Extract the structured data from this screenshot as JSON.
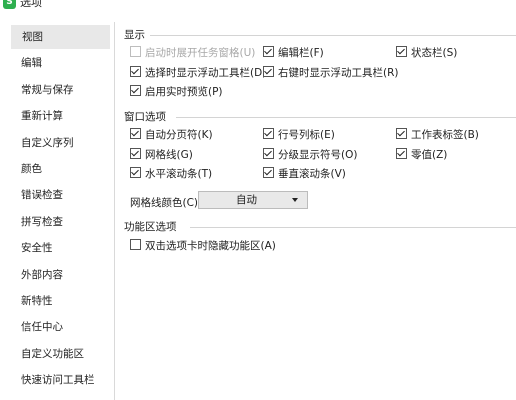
{
  "window": {
    "title": "选项",
    "app_icon_letter": "S"
  },
  "sidebar": {
    "items": [
      {
        "label": "视图",
        "active": true
      },
      {
        "label": "编辑"
      },
      {
        "label": "常规与保存"
      },
      {
        "label": "重新计算"
      },
      {
        "label": "自定义序列"
      },
      {
        "label": "颜色"
      },
      {
        "label": "错误检查"
      },
      {
        "label": "拼写检查"
      },
      {
        "label": "安全性"
      },
      {
        "label": "外部内容"
      },
      {
        "label": "新特性"
      },
      {
        "label": "信任中心"
      },
      {
        "label": "自定义功能区"
      },
      {
        "label": "快速访问工具栏"
      }
    ]
  },
  "display": {
    "title": "显示",
    "opts": {
      "startup_taskpane": {
        "label": "启动时展开任务窗格(U)",
        "checked": false,
        "disabled": true
      },
      "formula_bar": {
        "label": "编辑栏(F)",
        "checked": true
      },
      "status_bar": {
        "label": "状态栏(S)",
        "checked": true
      },
      "float_toolbar_select": {
        "label": "选择时显示浮动工具栏(D)",
        "checked": true
      },
      "float_toolbar_rightclick": {
        "label": "右键时显示浮动工具栏(R)",
        "checked": true
      },
      "live_preview": {
        "label": "启用实时预览(P)",
        "checked": true
      }
    }
  },
  "window_options": {
    "title": "窗口选项",
    "opts": {
      "auto_page_break": {
        "label": "自动分页符(K)",
        "checked": true
      },
      "row_col_headers": {
        "label": "行号列标(E)",
        "checked": true
      },
      "sheet_tabs": {
        "label": "工作表标签(B)",
        "checked": true
      },
      "gridlines": {
        "label": "网格线(G)",
        "checked": true
      },
      "outline_symbols": {
        "label": "分级显示符号(O)",
        "checked": true
      },
      "zero_values": {
        "label": "零值(Z)",
        "checked": true
      },
      "h_scrollbar": {
        "label": "水平滚动条(T)",
        "checked": true
      },
      "v_scrollbar": {
        "label": "垂直滚动条(V)",
        "checked": true
      }
    },
    "grid_color_label": "网格线颜色(C):",
    "grid_color_value": "自动"
  },
  "ribbon": {
    "title": "功能区选项",
    "opts": {
      "hide_ribbon_dblclick": {
        "label": "双击选项卡时隐藏功能区(A)",
        "checked": false
      }
    }
  }
}
